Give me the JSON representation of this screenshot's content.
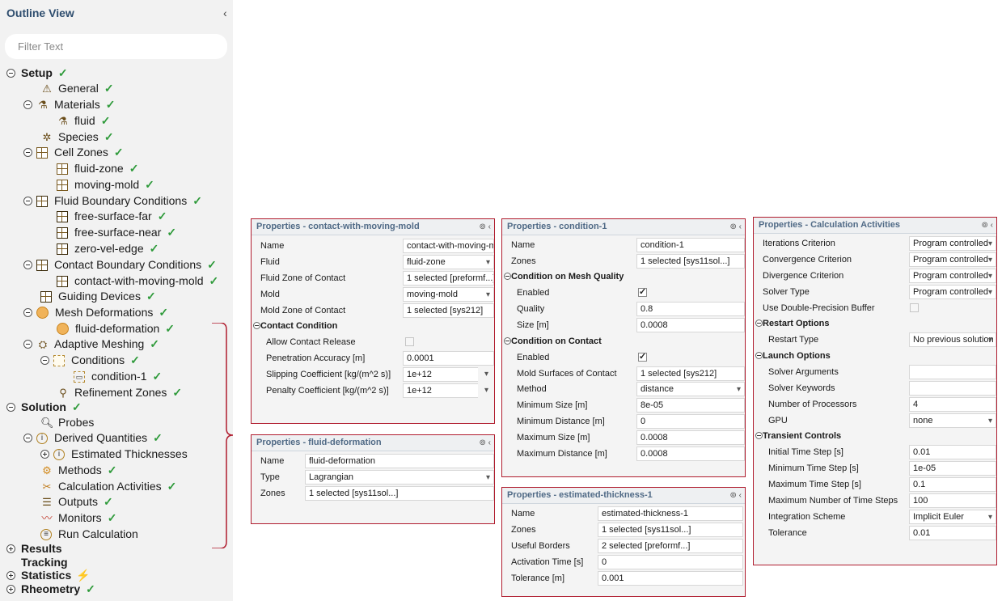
{
  "outline": {
    "title": "Outline View",
    "filter_placeholder": "Filter Text",
    "tree": {
      "setup": "Setup",
      "general": "General",
      "materials": "Materials",
      "fluid": "fluid",
      "species": "Species",
      "cell_zones": "Cell Zones",
      "fluid_zone": "fluid-zone",
      "moving_mold": "moving-mold",
      "fluid_bc": "Fluid Boundary Conditions",
      "free_surface_far": "free-surface-far",
      "free_surface_near": "free-surface-near",
      "zero_vel_edge": "zero-vel-edge",
      "contact_bc": "Contact Boundary Conditions",
      "contact_with_moving_mold": "contact-with-moving-mold",
      "guiding_devices": "Guiding Devices",
      "mesh_deformations": "Mesh Deformations",
      "fluid_deformation": "fluid-deformation",
      "adaptive_meshing": "Adaptive Meshing",
      "conditions": "Conditions",
      "condition_1": "condition-1",
      "refinement_zones": "Refinement Zones",
      "solution": "Solution",
      "probes": "Probes",
      "derived_quantities": "Derived Quantities",
      "estimated_thicknesses": "Estimated Thicknesses",
      "methods": "Methods",
      "calculation_activities": "Calculation Activities",
      "outputs": "Outputs",
      "monitors": "Monitors",
      "run_calculation": "Run Calculation",
      "results": "Results",
      "tracking": "Tracking",
      "statistics": "Statistics",
      "rheometry": "Rheometry"
    }
  },
  "panel_contact": {
    "title": "Properties - contact-with-moving-mold",
    "name_label": "Name",
    "name_value": "contact-with-moving-m...",
    "fluid_label": "Fluid",
    "fluid_value": "fluid-zone",
    "fluid_zone_label": "Fluid Zone of Contact",
    "fluid_zone_value": "1 selected [preformf...]",
    "mold_label": "Mold",
    "mold_value": "moving-mold",
    "mold_zone_label": "Mold Zone of Contact",
    "mold_zone_value": "1 selected [sys212]",
    "section": "Contact Condition",
    "allow_release_label": "Allow Contact Release",
    "penetration_label": "Penetration Accuracy [m]",
    "penetration_value": "0.0001",
    "slipping_label": "Slipping Coefficient [kg/(m^2 s)]",
    "slipping_value": "1e+12",
    "penalty_label": "Penalty Coefficient [kg/(m^2 s)]",
    "penalty_value": "1e+12"
  },
  "panel_deform": {
    "title": "Properties - fluid-deformation",
    "name_label": "Name",
    "name_value": "fluid-deformation",
    "type_label": "Type",
    "type_value": "Lagrangian",
    "zones_label": "Zones",
    "zones_value": "1 selected [sys11sol...]"
  },
  "panel_condition": {
    "title": "Properties - condition-1",
    "name_label": "Name",
    "name_value": "condition-1",
    "zones_label": "Zones",
    "zones_value": "1 selected [sys11sol...]",
    "section_mesh": "Condition on Mesh Quality",
    "enabled_label": "Enabled",
    "quality_label": "Quality",
    "quality_value": "0.8",
    "size_label": "Size [m]",
    "size_value": "0.0008",
    "section_contact": "Condition on Contact",
    "enabled2_label": "Enabled",
    "mold_surfaces_label": "Mold Surfaces of Contact",
    "mold_surfaces_value": "1 selected [sys212]",
    "method_label": "Method",
    "method_value": "distance",
    "min_size_label": "Minimum Size [m]",
    "min_size_value": "8e-05",
    "min_dist_label": "Minimum Distance [m]",
    "min_dist_value": "0",
    "max_size_label": "Maximum Size [m]",
    "max_size_value": "0.0008",
    "max_dist_label": "Maximum Distance [m]",
    "max_dist_value": "0.0008"
  },
  "panel_thickness": {
    "title": "Properties - estimated-thickness-1",
    "name_label": "Name",
    "name_value": "estimated-thickness-1",
    "zones_label": "Zones",
    "zones_value": "1 selected [sys11sol...]",
    "borders_label": "Useful Borders",
    "borders_value": "2 selected [preformf...]",
    "activation_label": "Activation Time [s]",
    "activation_value": "0",
    "tolerance_label": "Tolerance [m]",
    "tolerance_value": "0.001"
  },
  "panel_calc": {
    "title": "Properties - Calculation Activities",
    "iter_label": "Iterations Criterion",
    "iter_value": "Program controlled",
    "conv_label": "Convergence Criterion",
    "conv_value": "Program controlled",
    "div_label": "Divergence Criterion",
    "div_value": "Program controlled",
    "solver_type_label": "Solver Type",
    "solver_type_value": "Program controlled",
    "double_label": "Use Double-Precision Buffer",
    "restart_section": "Restart Options",
    "restart_type_label": "Restart Type",
    "restart_type_value": "No previous solution",
    "launch_section": "Launch Options",
    "solver_args_label": "Solver Arguments",
    "solver_args_value": "",
    "solver_kw_label": "Solver Keywords",
    "solver_kw_value": "",
    "procs_label": "Number of Processors",
    "procs_value": "4",
    "gpu_label": "GPU",
    "gpu_value": "none",
    "transient_section": "Transient Controls",
    "init_step_label": "Initial Time Step [s]",
    "init_step_value": "0.01",
    "min_step_label": "Minimum Time Step [s]",
    "min_step_value": "1e-05",
    "max_step_label": "Maximum Time Step [s]",
    "max_step_value": "0.1",
    "max_num_label": "Maximum Number of Time Steps",
    "max_num_value": "100",
    "scheme_label": "Integration Scheme",
    "scheme_value": "Implicit Euler",
    "tol_label": "Tolerance",
    "tol_value": "0.01"
  },
  "colors": {
    "accent_border": "#b01c2e",
    "check": "#2e9a3a",
    "title": "#2e4d6e"
  }
}
